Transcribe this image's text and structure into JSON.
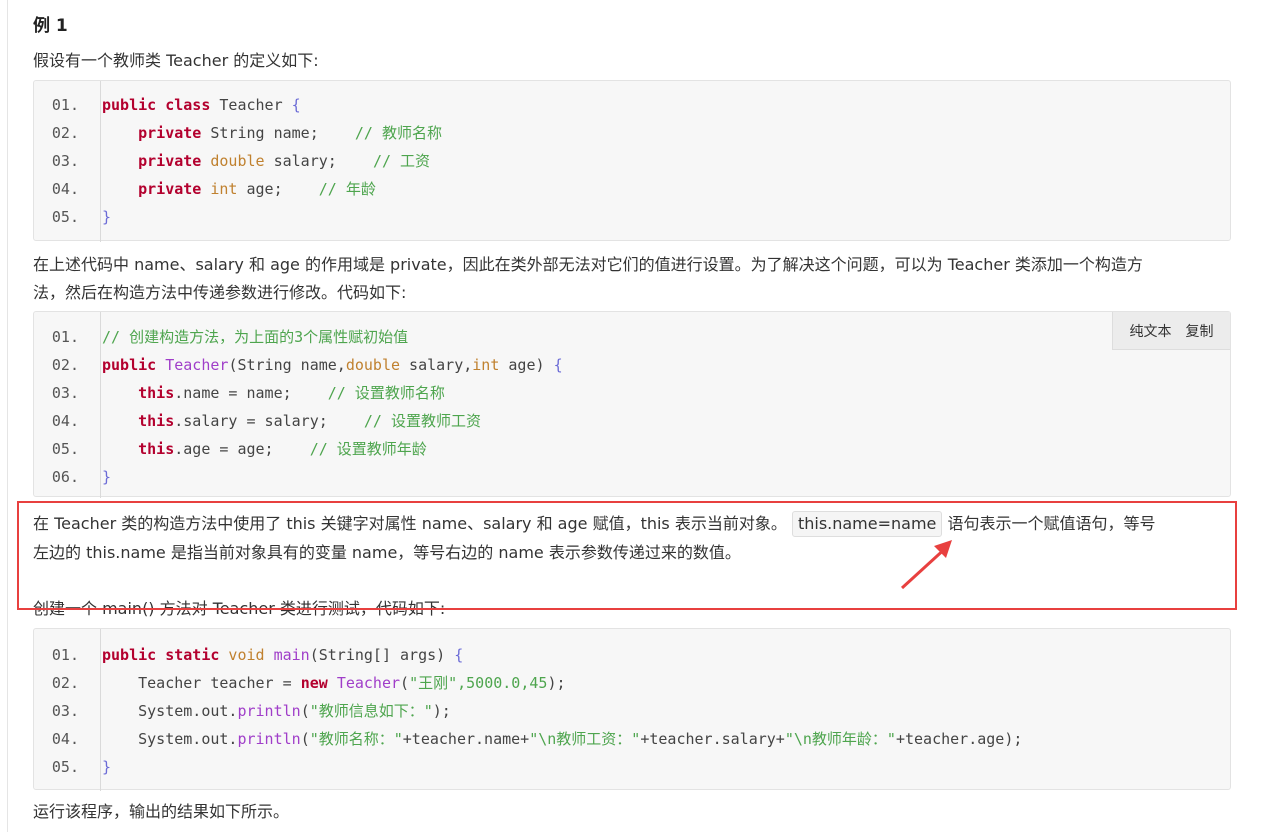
{
  "heading": "例 1",
  "intro": "假设有一个教师类 Teacher 的定义如下:",
  "code1": [
    {
      "num": "01.",
      "tokens": [
        {
          "c": "kw",
          "t": "public class"
        },
        {
          "c": "id",
          "t": " Teacher "
        },
        {
          "c": "br",
          "t": "{"
        }
      ]
    },
    {
      "num": "02.",
      "tokens": [
        {
          "c": "id",
          "t": "    "
        },
        {
          "c": "kw",
          "t": "private"
        },
        {
          "c": "id",
          "t": " String name;    "
        },
        {
          "c": "cm",
          "t": "// 教师名称"
        }
      ]
    },
    {
      "num": "03.",
      "tokens": [
        {
          "c": "id",
          "t": "    "
        },
        {
          "c": "kw",
          "t": "private"
        },
        {
          "c": "ty",
          "t": " double"
        },
        {
          "c": "id",
          "t": " salary;    "
        },
        {
          "c": "cm",
          "t": "// 工资"
        }
      ]
    },
    {
      "num": "04.",
      "tokens": [
        {
          "c": "id",
          "t": "    "
        },
        {
          "c": "kw",
          "t": "private"
        },
        {
          "c": "ty",
          "t": " int"
        },
        {
          "c": "id",
          "t": " age;    "
        },
        {
          "c": "cm",
          "t": "// 年龄"
        }
      ]
    },
    {
      "num": "05.",
      "tokens": [
        {
          "c": "br",
          "t": "}"
        }
      ]
    }
  ],
  "para2_line1": "在上述代码中 name、salary 和 age 的作用域是 private，因此在类外部无法对它们的值进行设置。为了解决这个问题，可以为 Teacher 类添加一个构造方",
  "para2_line2": "法，然后在构造方法中传递参数进行修改。代码如下:",
  "toolbar": {
    "plain_text": "纯文本",
    "copy": "复制"
  },
  "code2": [
    {
      "num": "01.",
      "tokens": [
        {
          "c": "cm",
          "t": "// 创建构造方法，为上面的3个属性赋初始值"
        }
      ]
    },
    {
      "num": "02.",
      "tokens": [
        {
          "c": "kw",
          "t": "public"
        },
        {
          "c": "id",
          "t": " "
        },
        {
          "c": "fn",
          "t": "Teacher"
        },
        {
          "c": "id",
          "t": "(String name,"
        },
        {
          "c": "ty",
          "t": "double"
        },
        {
          "c": "id",
          "t": " salary,"
        },
        {
          "c": "ty",
          "t": "int"
        },
        {
          "c": "id",
          "t": " age) "
        },
        {
          "c": "br",
          "t": "{"
        }
      ]
    },
    {
      "num": "03.",
      "tokens": [
        {
          "c": "id",
          "t": "    "
        },
        {
          "c": "kw",
          "t": "this"
        },
        {
          "c": "id",
          "t": ".name = name;    "
        },
        {
          "c": "cm",
          "t": "// 设置教师名称"
        }
      ]
    },
    {
      "num": "04.",
      "tokens": [
        {
          "c": "id",
          "t": "    "
        },
        {
          "c": "kw",
          "t": "this"
        },
        {
          "c": "id",
          "t": ".salary = salary;    "
        },
        {
          "c": "cm",
          "t": "// 设置教师工资"
        }
      ]
    },
    {
      "num": "05.",
      "tokens": [
        {
          "c": "id",
          "t": "    "
        },
        {
          "c": "kw",
          "t": "this"
        },
        {
          "c": "id",
          "t": ".age = age;    "
        },
        {
          "c": "cm",
          "t": "// 设置教师年龄"
        }
      ]
    },
    {
      "num": "06.",
      "tokens": [
        {
          "c": "br",
          "t": "}"
        }
      ]
    }
  ],
  "para3_line1_a": "在 Teacher 类的构造方法中使用了 this 关键字对属性 name、salary 和 age 赋值，this 表示当前对象。",
  "para3_inline_code": "this.name=name",
  "para3_line1_b": "语句表示一个赋值语句，等号",
  "para3_line2": "左边的 this.name 是指当前对象具有的变量 name，等号右边的 name 表示参数传递过来的数值。",
  "para4": "创建一个 main() 方法对 Teacher 类进行测试，代码如下:",
  "code3": [
    {
      "num": "01.",
      "tokens": [
        {
          "c": "kw",
          "t": "public static"
        },
        {
          "c": "ty",
          "t": " void"
        },
        {
          "c": "id",
          "t": " "
        },
        {
          "c": "fn",
          "t": "main"
        },
        {
          "c": "id",
          "t": "(String[] args) "
        },
        {
          "c": "br",
          "t": "{"
        }
      ]
    },
    {
      "num": "02.",
      "tokens": [
        {
          "c": "id",
          "t": "    Teacher teacher = "
        },
        {
          "c": "kw",
          "t": "new"
        },
        {
          "c": "id",
          "t": " "
        },
        {
          "c": "fn",
          "t": "Teacher"
        },
        {
          "c": "id",
          "t": "("
        },
        {
          "c": "str",
          "t": "\"王刚\",5000.0,45"
        },
        {
          "c": "id",
          "t": ");"
        }
      ]
    },
    {
      "num": "03.",
      "tokens": [
        {
          "c": "id",
          "t": "    System.out."
        },
        {
          "c": "fn",
          "t": "println"
        },
        {
          "c": "id",
          "t": "("
        },
        {
          "c": "str",
          "t": "\"教师信息如下：\""
        },
        {
          "c": "id",
          "t": ");"
        }
      ]
    },
    {
      "num": "04.",
      "tokens": [
        {
          "c": "id",
          "t": "    System.out."
        },
        {
          "c": "fn",
          "t": "println"
        },
        {
          "c": "id",
          "t": "("
        },
        {
          "c": "str",
          "t": "\"教师名称：\""
        },
        {
          "c": "id",
          "t": "+teacher.name+"
        },
        {
          "c": "str",
          "t": "\"\\n教师工资：\""
        },
        {
          "c": "id",
          "t": "+teacher.salary+"
        },
        {
          "c": "str",
          "t": "\"\\n教师年龄：\""
        },
        {
          "c": "id",
          "t": "+teacher.age);"
        }
      ]
    },
    {
      "num": "05.",
      "tokens": [
        {
          "c": "br",
          "t": "}"
        }
      ]
    }
  ],
  "para5": "运行该程序，输出的结果如下所示。",
  "colors": {
    "highlight": "#e8403f",
    "keyword": "#b3002e",
    "comment": "#4ea54e",
    "type": "#c0812f",
    "function": "#a03ec9"
  }
}
